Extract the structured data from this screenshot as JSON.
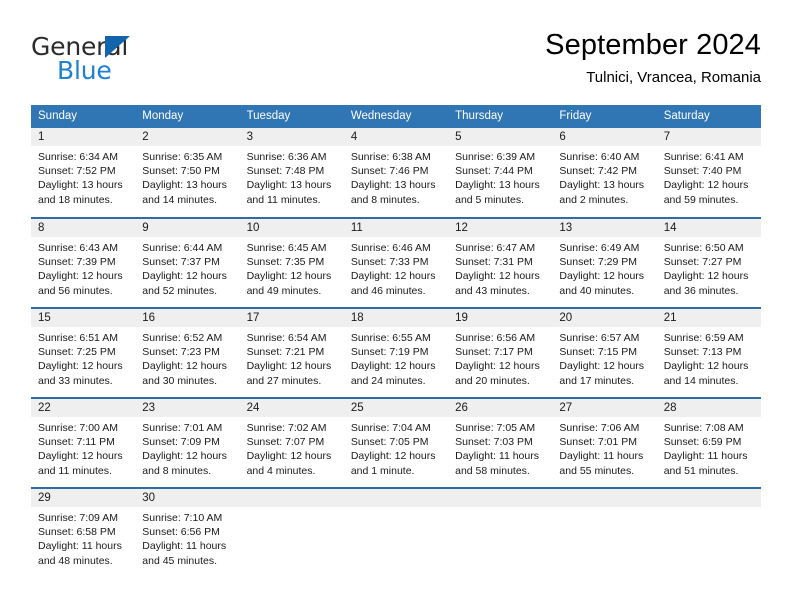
{
  "brand": {
    "name_part1": "General",
    "name_part2": "Blue",
    "accent_color": "#1f7fd0",
    "triangle_color": "#1265ac"
  },
  "header": {
    "title": "September 2024",
    "subtitle": "Tulnici, Vrancea, Romania"
  },
  "theme": {
    "header_bg": "#3075b4",
    "row_divider": "#2e6da4",
    "daynum_band": "#efefef"
  },
  "weekday_headers": [
    "Sunday",
    "Monday",
    "Tuesday",
    "Wednesday",
    "Thursday",
    "Friday",
    "Saturday"
  ],
  "days": [
    {
      "day": "1",
      "sunrise": "Sunrise: 6:34 AM",
      "sunset": "Sunset: 7:52 PM",
      "daylight_l1": "Daylight: 13 hours",
      "daylight_l2": "and 18 minutes."
    },
    {
      "day": "2",
      "sunrise": "Sunrise: 6:35 AM",
      "sunset": "Sunset: 7:50 PM",
      "daylight_l1": "Daylight: 13 hours",
      "daylight_l2": "and 14 minutes."
    },
    {
      "day": "3",
      "sunrise": "Sunrise: 6:36 AM",
      "sunset": "Sunset: 7:48 PM",
      "daylight_l1": "Daylight: 13 hours",
      "daylight_l2": "and 11 minutes."
    },
    {
      "day": "4",
      "sunrise": "Sunrise: 6:38 AM",
      "sunset": "Sunset: 7:46 PM",
      "daylight_l1": "Daylight: 13 hours",
      "daylight_l2": "and 8 minutes."
    },
    {
      "day": "5",
      "sunrise": "Sunrise: 6:39 AM",
      "sunset": "Sunset: 7:44 PM",
      "daylight_l1": "Daylight: 13 hours",
      "daylight_l2": "and 5 minutes."
    },
    {
      "day": "6",
      "sunrise": "Sunrise: 6:40 AM",
      "sunset": "Sunset: 7:42 PM",
      "daylight_l1": "Daylight: 13 hours",
      "daylight_l2": "and 2 minutes."
    },
    {
      "day": "7",
      "sunrise": "Sunrise: 6:41 AM",
      "sunset": "Sunset: 7:40 PM",
      "daylight_l1": "Daylight: 12 hours",
      "daylight_l2": "and 59 minutes."
    },
    {
      "day": "8",
      "sunrise": "Sunrise: 6:43 AM",
      "sunset": "Sunset: 7:39 PM",
      "daylight_l1": "Daylight: 12 hours",
      "daylight_l2": "and 56 minutes."
    },
    {
      "day": "9",
      "sunrise": "Sunrise: 6:44 AM",
      "sunset": "Sunset: 7:37 PM",
      "daylight_l1": "Daylight: 12 hours",
      "daylight_l2": "and 52 minutes."
    },
    {
      "day": "10",
      "sunrise": "Sunrise: 6:45 AM",
      "sunset": "Sunset: 7:35 PM",
      "daylight_l1": "Daylight: 12 hours",
      "daylight_l2": "and 49 minutes."
    },
    {
      "day": "11",
      "sunrise": "Sunrise: 6:46 AM",
      "sunset": "Sunset: 7:33 PM",
      "daylight_l1": "Daylight: 12 hours",
      "daylight_l2": "and 46 minutes."
    },
    {
      "day": "12",
      "sunrise": "Sunrise: 6:47 AM",
      "sunset": "Sunset: 7:31 PM",
      "daylight_l1": "Daylight: 12 hours",
      "daylight_l2": "and 43 minutes."
    },
    {
      "day": "13",
      "sunrise": "Sunrise: 6:49 AM",
      "sunset": "Sunset: 7:29 PM",
      "daylight_l1": "Daylight: 12 hours",
      "daylight_l2": "and 40 minutes."
    },
    {
      "day": "14",
      "sunrise": "Sunrise: 6:50 AM",
      "sunset": "Sunset: 7:27 PM",
      "daylight_l1": "Daylight: 12 hours",
      "daylight_l2": "and 36 minutes."
    },
    {
      "day": "15",
      "sunrise": "Sunrise: 6:51 AM",
      "sunset": "Sunset: 7:25 PM",
      "daylight_l1": "Daylight: 12 hours",
      "daylight_l2": "and 33 minutes."
    },
    {
      "day": "16",
      "sunrise": "Sunrise: 6:52 AM",
      "sunset": "Sunset: 7:23 PM",
      "daylight_l1": "Daylight: 12 hours",
      "daylight_l2": "and 30 minutes."
    },
    {
      "day": "17",
      "sunrise": "Sunrise: 6:54 AM",
      "sunset": "Sunset: 7:21 PM",
      "daylight_l1": "Daylight: 12 hours",
      "daylight_l2": "and 27 minutes."
    },
    {
      "day": "18",
      "sunrise": "Sunrise: 6:55 AM",
      "sunset": "Sunset: 7:19 PM",
      "daylight_l1": "Daylight: 12 hours",
      "daylight_l2": "and 24 minutes."
    },
    {
      "day": "19",
      "sunrise": "Sunrise: 6:56 AM",
      "sunset": "Sunset: 7:17 PM",
      "daylight_l1": "Daylight: 12 hours",
      "daylight_l2": "and 20 minutes."
    },
    {
      "day": "20",
      "sunrise": "Sunrise: 6:57 AM",
      "sunset": "Sunset: 7:15 PM",
      "daylight_l1": "Daylight: 12 hours",
      "daylight_l2": "and 17 minutes."
    },
    {
      "day": "21",
      "sunrise": "Sunrise: 6:59 AM",
      "sunset": "Sunset: 7:13 PM",
      "daylight_l1": "Daylight: 12 hours",
      "daylight_l2": "and 14 minutes."
    },
    {
      "day": "22",
      "sunrise": "Sunrise: 7:00 AM",
      "sunset": "Sunset: 7:11 PM",
      "daylight_l1": "Daylight: 12 hours",
      "daylight_l2": "and 11 minutes."
    },
    {
      "day": "23",
      "sunrise": "Sunrise: 7:01 AM",
      "sunset": "Sunset: 7:09 PM",
      "daylight_l1": "Daylight: 12 hours",
      "daylight_l2": "and 8 minutes."
    },
    {
      "day": "24",
      "sunrise": "Sunrise: 7:02 AM",
      "sunset": "Sunset: 7:07 PM",
      "daylight_l1": "Daylight: 12 hours",
      "daylight_l2": "and 4 minutes."
    },
    {
      "day": "25",
      "sunrise": "Sunrise: 7:04 AM",
      "sunset": "Sunset: 7:05 PM",
      "daylight_l1": "Daylight: 12 hours",
      "daylight_l2": "and 1 minute."
    },
    {
      "day": "26",
      "sunrise": "Sunrise: 7:05 AM",
      "sunset": "Sunset: 7:03 PM",
      "daylight_l1": "Daylight: 11 hours",
      "daylight_l2": "and 58 minutes."
    },
    {
      "day": "27",
      "sunrise": "Sunrise: 7:06 AM",
      "sunset": "Sunset: 7:01 PM",
      "daylight_l1": "Daylight: 11 hours",
      "daylight_l2": "and 55 minutes."
    },
    {
      "day": "28",
      "sunrise": "Sunrise: 7:08 AM",
      "sunset": "Sunset: 6:59 PM",
      "daylight_l1": "Daylight: 11 hours",
      "daylight_l2": "and 51 minutes."
    },
    {
      "day": "29",
      "sunrise": "Sunrise: 7:09 AM",
      "sunset": "Sunset: 6:58 PM",
      "daylight_l1": "Daylight: 11 hours",
      "daylight_l2": "and 48 minutes."
    },
    {
      "day": "30",
      "sunrise": "Sunrise: 7:10 AM",
      "sunset": "Sunset: 6:56 PM",
      "daylight_l1": "Daylight: 11 hours",
      "daylight_l2": "and 45 minutes."
    }
  ],
  "leading_blanks": 0,
  "trailing_blanks": 5
}
